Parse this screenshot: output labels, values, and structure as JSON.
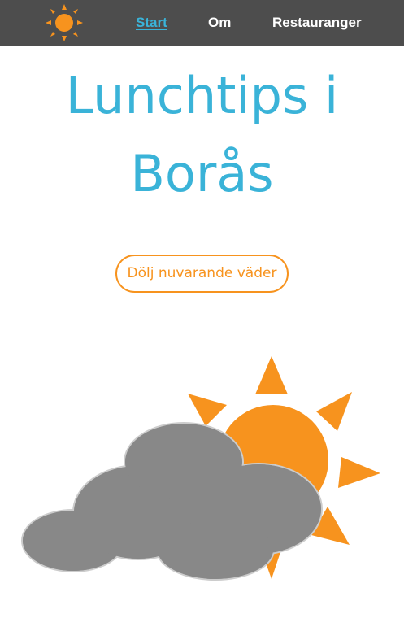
{
  "nav": {
    "logo_icon": "sun-icon",
    "links": [
      {
        "label": "Start",
        "active": true
      },
      {
        "label": "Om",
        "active": false
      },
      {
        "label": "Restauranger",
        "active": false
      }
    ]
  },
  "main": {
    "title": "Lunchtips i Borås",
    "toggle_weather_label": "Dölj nuvarande väder",
    "weather_icon": "partly-cloudy-icon"
  },
  "colors": {
    "nav_background": "#4d4d4d",
    "accent_blue": "#3ab3d8",
    "accent_orange": "#f7931e",
    "cloud_gray": "#888888"
  }
}
